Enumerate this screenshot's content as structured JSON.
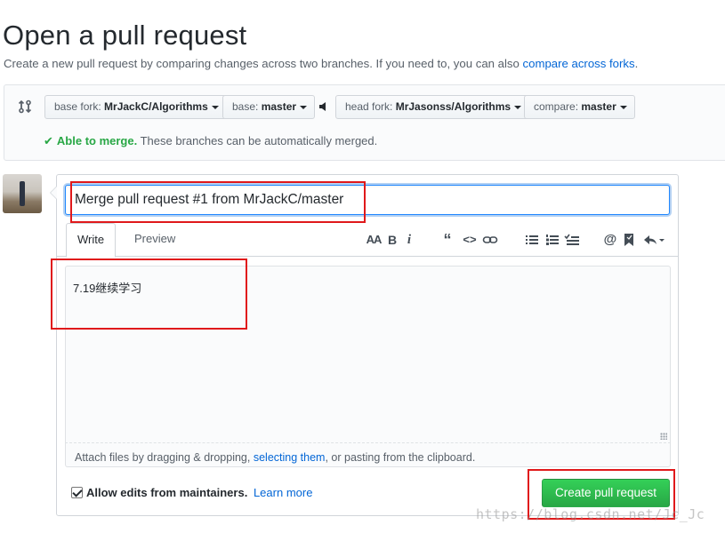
{
  "page": {
    "title": "Open a pull request",
    "description": "Create a new pull request by comparing changes across two branches. If you need to, you can also",
    "compare_forks_link": "compare across forks",
    "description_end": "."
  },
  "range": {
    "base_fork": {
      "label": "base fork:",
      "value": "MrJackC/Algorithms"
    },
    "base": {
      "label": "base:",
      "value": "master"
    },
    "head_fork": {
      "label": "head fork:",
      "value": "MrJasonss/Algorithms"
    },
    "compare": {
      "label": "compare:",
      "value": "master"
    },
    "merge_status_ok": "Able to merge.",
    "merge_status_text": "These branches can be automatically merged."
  },
  "form": {
    "title_value": "Merge pull request #1 from MrJackC/master",
    "tabs": [
      {
        "label": "Write",
        "active": true
      },
      {
        "label": "Preview",
        "active": false
      }
    ],
    "toolbar_icons": [
      "header-icon",
      "bold-icon",
      "italic-icon",
      "quote-icon",
      "code-icon",
      "link-icon",
      "bulleted-list-icon",
      "numbered-list-icon",
      "task-list-icon",
      "mention-icon",
      "bookmark-icon",
      "reply-icon"
    ],
    "body_text": "7.19继续学习",
    "attach": {
      "before": "Attach files by dragging & dropping,",
      "link": "selecting them",
      "after": ", or pasting from the clipboard."
    },
    "allow_edits_label": "Allow edits from maintainers.",
    "allow_edits_checked": true,
    "learn_more": "Learn more",
    "submit_label": "Create pull request"
  },
  "watermark": "https://blog.csdn.net/Jc_Jc",
  "colors": {
    "link": "#0366d6",
    "success": "#28a745",
    "annotation": "#e0191b",
    "focus": "#2188ff"
  }
}
